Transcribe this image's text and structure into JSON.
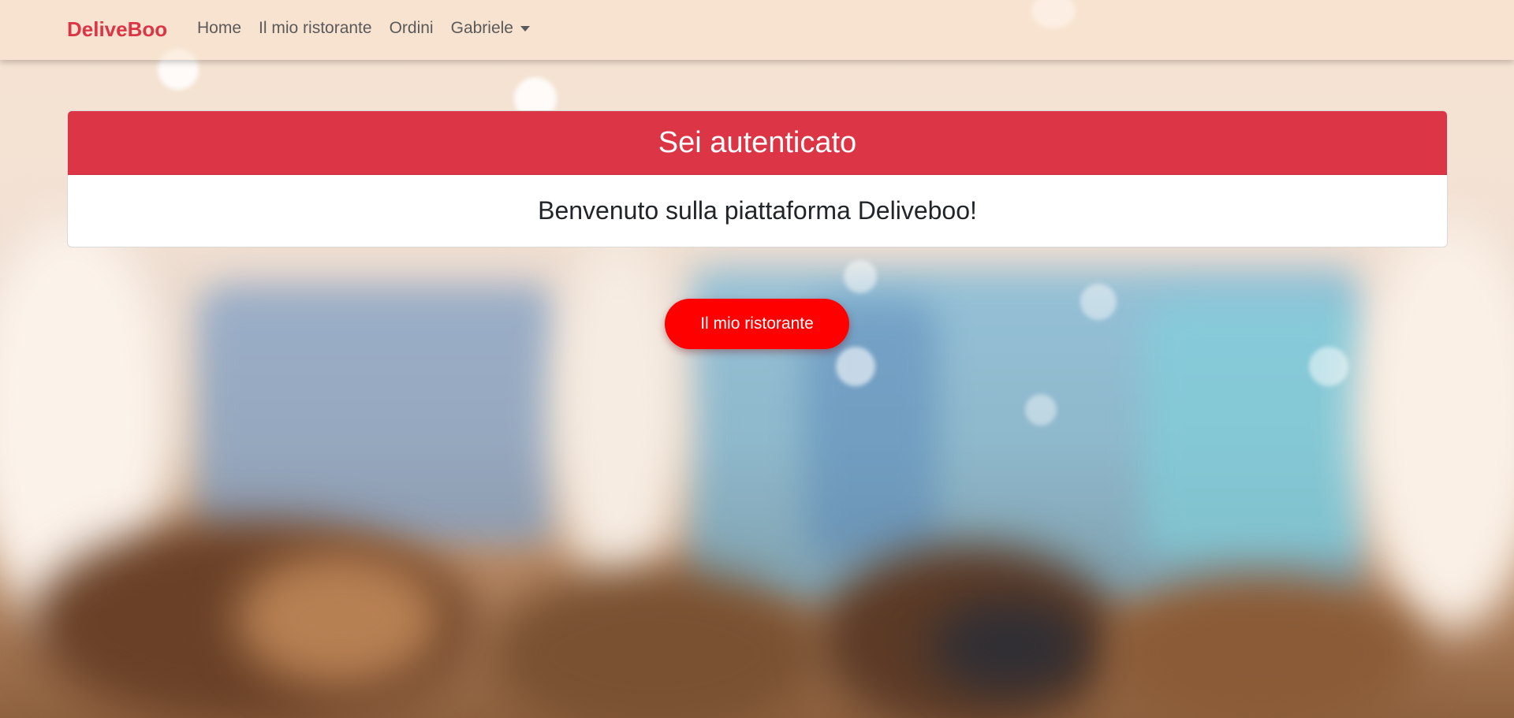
{
  "navbar": {
    "brand": "DeliveBoo",
    "links": [
      "Home",
      "Il mio ristorante",
      "Ordini"
    ],
    "user_menu": "Gabriele"
  },
  "card": {
    "header": "Sei autenticato",
    "body": "Benvenuto sulla piattaforma Deliveboo!"
  },
  "main_button": {
    "label": "Il mio ristorante"
  },
  "colors": {
    "brand": "#dc3545",
    "card_header": "#dc3545",
    "button": "#ff0000"
  }
}
